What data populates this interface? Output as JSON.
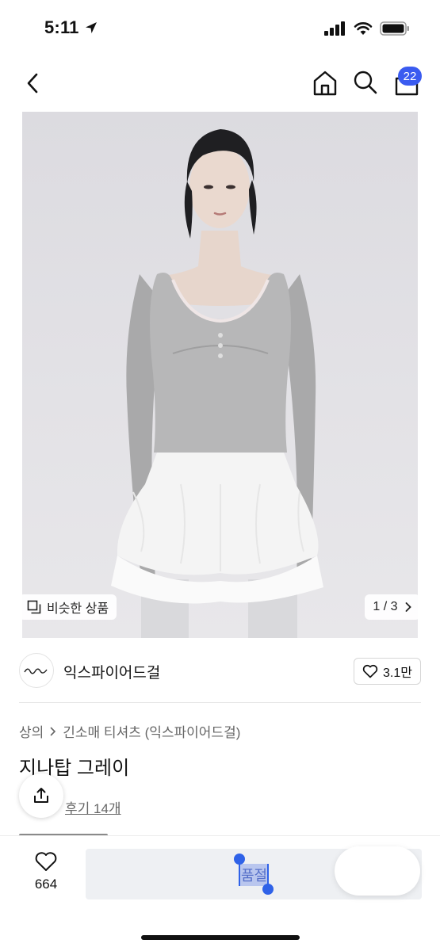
{
  "status_bar": {
    "time": "5:11"
  },
  "nav": {
    "cart_count": "22"
  },
  "gallery": {
    "similar_label": "비슷한 상품",
    "page_indicator": "1 / 3"
  },
  "brand": {
    "name": "익스파이어드걸",
    "like_count": "3.1만"
  },
  "breadcrumb": {
    "category": "상의",
    "subcategory": "긴소매 티셔츠 (익스파이어드걸)"
  },
  "product": {
    "title": "지나탑 그레이",
    "reviews_label": "후기 14개"
  },
  "bottom_bar": {
    "wish_count": "664",
    "buy_label": "품절"
  },
  "colors": {
    "badge_blue": "#3a5bf0",
    "selection_blue": "#2f62e8"
  }
}
